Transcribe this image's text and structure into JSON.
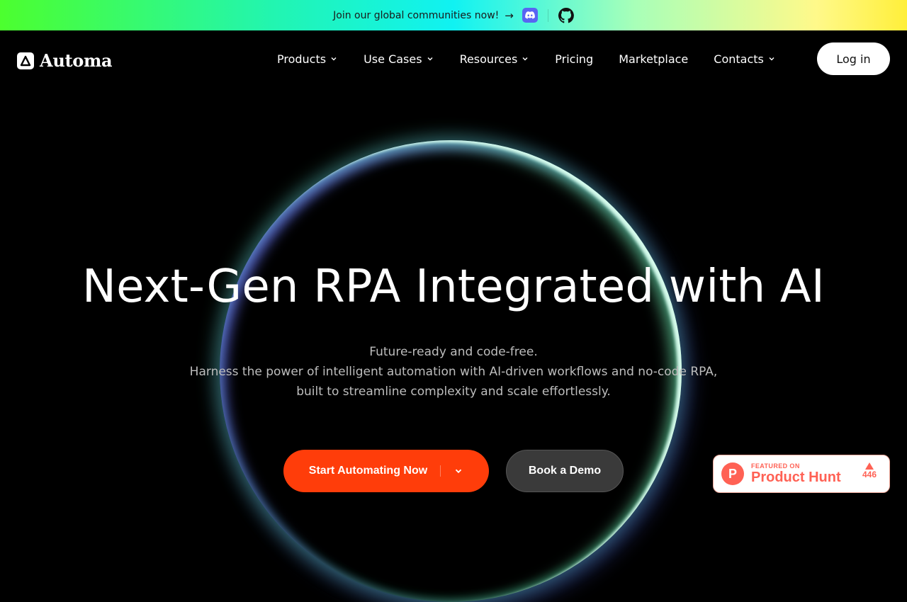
{
  "banner": {
    "text": "Join our global communities now!",
    "arrow": "→",
    "icons": [
      "discord-icon",
      "github-icon"
    ]
  },
  "brand": {
    "name": "Automa"
  },
  "nav": {
    "items": [
      {
        "label": "Products",
        "dropdown": true
      },
      {
        "label": "Use Cases",
        "dropdown": true
      },
      {
        "label": "Resources",
        "dropdown": true
      },
      {
        "label": "Pricing",
        "dropdown": false
      },
      {
        "label": "Marketplace",
        "dropdown": false
      },
      {
        "label": "Contacts",
        "dropdown": true
      }
    ],
    "login_label": "Log in"
  },
  "hero": {
    "headline": "Next-Gen RPA Integrated with AI",
    "sub_lines": [
      "Future-ready and code-free.",
      "Harness the power of intelligent automation with AI-driven workflows and no-code RPA,",
      "built to streamline complexity and scale effortlessly."
    ],
    "primary_cta": "Start Automating Now",
    "secondary_cta": "Book a Demo"
  },
  "product_hunt": {
    "small": "FEATURED ON",
    "big": "Product Hunt",
    "votes": "446",
    "accent": "#ff6154"
  },
  "colors": {
    "cta": "#ff3d0a",
    "background": "#000000"
  }
}
